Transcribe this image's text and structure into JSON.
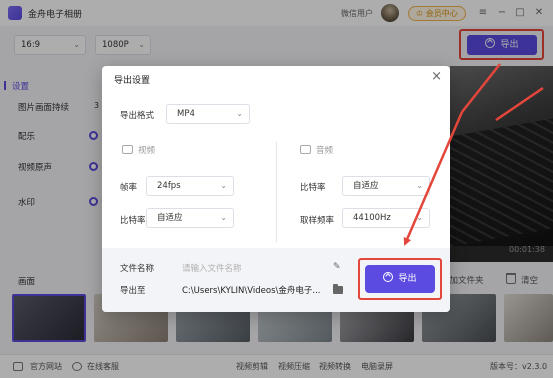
{
  "app": {
    "title": "金舟电子相册",
    "user": "微信用户",
    "vip_label": "会员中心"
  },
  "toolbar": {
    "ratio": "16:9",
    "resolution": "1080P",
    "export_label": "导出"
  },
  "left_panel": {
    "tab": "设置",
    "items": [
      {
        "label": "图片画面持续"
      },
      {
        "label": "配乐"
      },
      {
        "label": "视频原声"
      },
      {
        "label": "水印"
      }
    ],
    "duration_value": "3"
  },
  "preview": {
    "timecode": "00:01:38"
  },
  "timeline": {
    "label": "画面",
    "add_folder": "添加文件夹",
    "clear": "清空"
  },
  "bottombar": {
    "website": "官方网站",
    "service": "在线客服",
    "tools": [
      "视频剪辑",
      "视频压缩",
      "视频转换",
      "电脑录屏"
    ],
    "version": "版本号：v2.3.0"
  },
  "modal": {
    "title": "导出设置",
    "format_label": "导出格式",
    "format_value": "MP4",
    "video_section": "视频",
    "audio_section": "音频",
    "frame_rate_label": "帧率",
    "frame_rate_value": "24fps",
    "video_bitrate_label": "比特率",
    "video_bitrate_value": "自适应",
    "audio_bitrate_label": "比特率",
    "audio_bitrate_value": "自适应",
    "sample_rate_label": "取样频率",
    "sample_rate_value": "44100Hz",
    "filename_label": "文件名称",
    "filename_placeholder": "请输入文件名称",
    "export_to_label": "导出至",
    "export_path": "C:\\Users\\KYLIN\\Videos\\金舟电子...",
    "export_button": "导出"
  },
  "colors": {
    "accent": "#5b4be0",
    "highlight": "#e5463b"
  }
}
